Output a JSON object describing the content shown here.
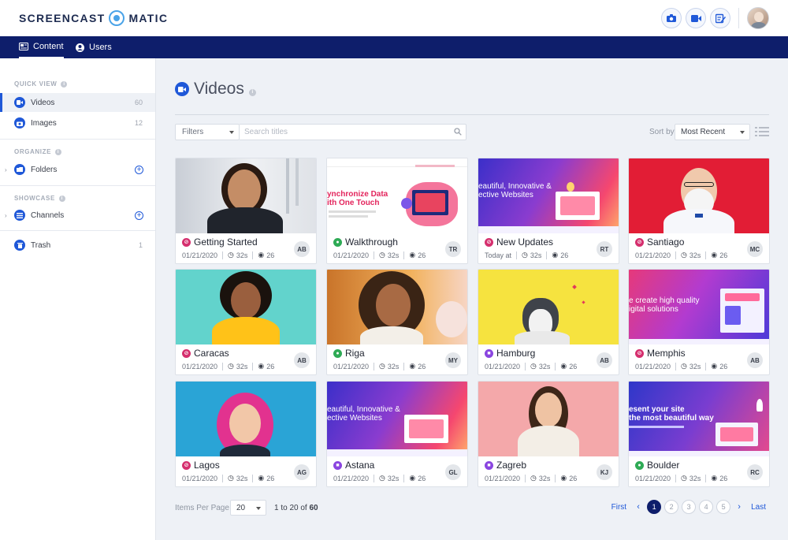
{
  "app": {
    "logo_left": "SCREENCAST",
    "logo_right": "MATIC"
  },
  "nav": {
    "tabs": [
      {
        "label": "Content",
        "icon": "content-icon",
        "active": true
      },
      {
        "label": "Users",
        "icon": "user-icon",
        "active": false
      }
    ]
  },
  "sidebar": {
    "quick_view": "QUICK VIEW",
    "organize": "ORGANIZE",
    "showcase": "SHOWCASE",
    "items": [
      {
        "label": "Videos",
        "count": "60",
        "icon": "video-icon",
        "active": true
      },
      {
        "label": "Images",
        "count": "12",
        "icon": "camera-icon"
      },
      {
        "label": "Folders",
        "icon": "folder-icon"
      },
      {
        "label": "Channels",
        "icon": "channel-icon"
      },
      {
        "label": "Trash",
        "count": "1",
        "icon": "trash-icon"
      }
    ]
  },
  "main": {
    "title": "Videos",
    "filters_label": "Filters",
    "search_placeholder": "Search titles",
    "sort_by_label": "Sort by",
    "sort_value": "Most Recent"
  },
  "cards": [
    {
      "title": "Getting Started",
      "visibility": "link",
      "date": "01/21/2020",
      "duration": "32s",
      "views": "26",
      "owner": "AB"
    },
    {
      "title": "Walkthrough",
      "visibility": "public",
      "date": "01/21/2020",
      "duration": "32s",
      "views": "26",
      "owner": "TR",
      "thumb_text": "ynchronize Data\nith One Touch"
    },
    {
      "title": "New Updates",
      "visibility": "link",
      "date": "Today at",
      "duration": "32s",
      "views": "26",
      "owner": "RT",
      "thumb_text": "eautiful, Innovative &\nective Websites"
    },
    {
      "title": "Santiago",
      "visibility": "link",
      "date": "01/21/2020",
      "duration": "32s",
      "views": "26",
      "owner": "MC"
    },
    {
      "title": "Caracas",
      "visibility": "link",
      "date": "01/21/2020",
      "duration": "32s",
      "views": "26",
      "owner": "AB"
    },
    {
      "title": "Riga",
      "visibility": "public",
      "date": "01/21/2020",
      "duration": "32s",
      "views": "26",
      "owner": "MY"
    },
    {
      "title": "Hamburg",
      "visibility": "private",
      "date": "01/21/2020",
      "duration": "32s",
      "views": "26",
      "owner": "AB"
    },
    {
      "title": "Memphis",
      "visibility": "link",
      "date": "01/21/2020",
      "duration": "32s",
      "views": "26",
      "owner": "AB",
      "thumb_text": "e create high quality\nigital solutions"
    },
    {
      "title": "Lagos",
      "visibility": "link",
      "date": "01/21/2020",
      "duration": "32s",
      "views": "26",
      "owner": "AG"
    },
    {
      "title": "Astana",
      "visibility": "private",
      "date": "01/21/2020",
      "duration": "32s",
      "views": "26",
      "owner": "GL",
      "thumb_text": "eautiful, Innovative &\nective Websites"
    },
    {
      "title": "Zagreb",
      "visibility": "private",
      "date": "01/21/2020",
      "duration": "32s",
      "views": "26",
      "owner": "KJ"
    },
    {
      "title": "Boulder",
      "visibility": "public",
      "date": "01/21/2020",
      "duration": "32s",
      "views": "26",
      "owner": "RC",
      "thumb_text": "esent your site\nthe most beautiful way"
    }
  ],
  "footer": {
    "items_per_page_label": "Items Per Page",
    "items_per_page": "20",
    "range_pre": "1 to 20",
    "range_of": "of",
    "range_total": "60",
    "first": "First",
    "last": "Last",
    "pages": [
      "1",
      "2",
      "3",
      "4",
      "5"
    ],
    "current_page": "1"
  },
  "colors": {
    "primary": "#1f58d8",
    "navbar": "#0e1e6b",
    "link_badge": "#d52f6e",
    "public_badge": "#2eaa55",
    "private_badge": "#8a45e0"
  }
}
